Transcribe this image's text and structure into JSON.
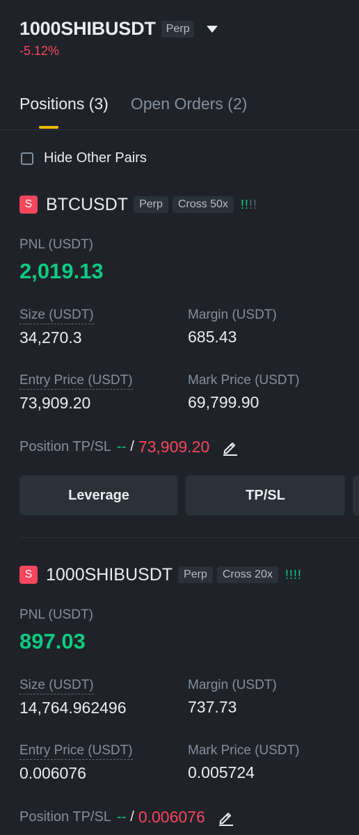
{
  "header": {
    "symbol": "1000SHIBUSDT",
    "badge": "Perp",
    "change": "-5.12%"
  },
  "tabs": [
    {
      "label": "Positions (3)",
      "active": true
    },
    {
      "label": "Open Orders (2)",
      "active": false
    }
  ],
  "filter": {
    "hide_other_pairs": "Hide Other Pairs",
    "checked": false
  },
  "positions": [
    {
      "side": "S",
      "symbol": "BTCUSDT",
      "type": "Perp",
      "margin_mode": "Cross 50x",
      "pnl_label": "PNL (USDT)",
      "pnl": "2,019.13",
      "size_label": "Size (USDT)",
      "size": "34,270.3",
      "margin_label": "Margin (USDT)",
      "margin": "685.43",
      "entry_label": "Entry Price (USDT)",
      "entry": "73,909.20",
      "mark_label": "Mark Price (USDT)",
      "mark": "69,799.90",
      "tpsl_label": "Position TP/SL",
      "tp": "--",
      "sl": "73,909.20",
      "leverage_button": "Leverage",
      "tpsl_button": "TP/SL"
    },
    {
      "side": "S",
      "symbol": "1000SHIBUSDT",
      "type": "Perp",
      "margin_mode": "Cross 20x",
      "pnl_label": "PNL (USDT)",
      "pnl": "897.03",
      "size_label": "Size (USDT)",
      "size": "14,764.962496",
      "margin_label": "Margin (USDT)",
      "margin": "737.73",
      "entry_label": "Entry Price (USDT)",
      "entry": "0.006076",
      "mark_label": "Mark Price (USDT)",
      "mark": "0.005724",
      "tpsl_label": "Position TP/SL",
      "tp": "--",
      "sl": "0.006076"
    }
  ],
  "colors": {
    "background": "#1f2329",
    "profit": "#0ecb81",
    "loss": "#f6465d",
    "accent": "#f0b90b"
  }
}
